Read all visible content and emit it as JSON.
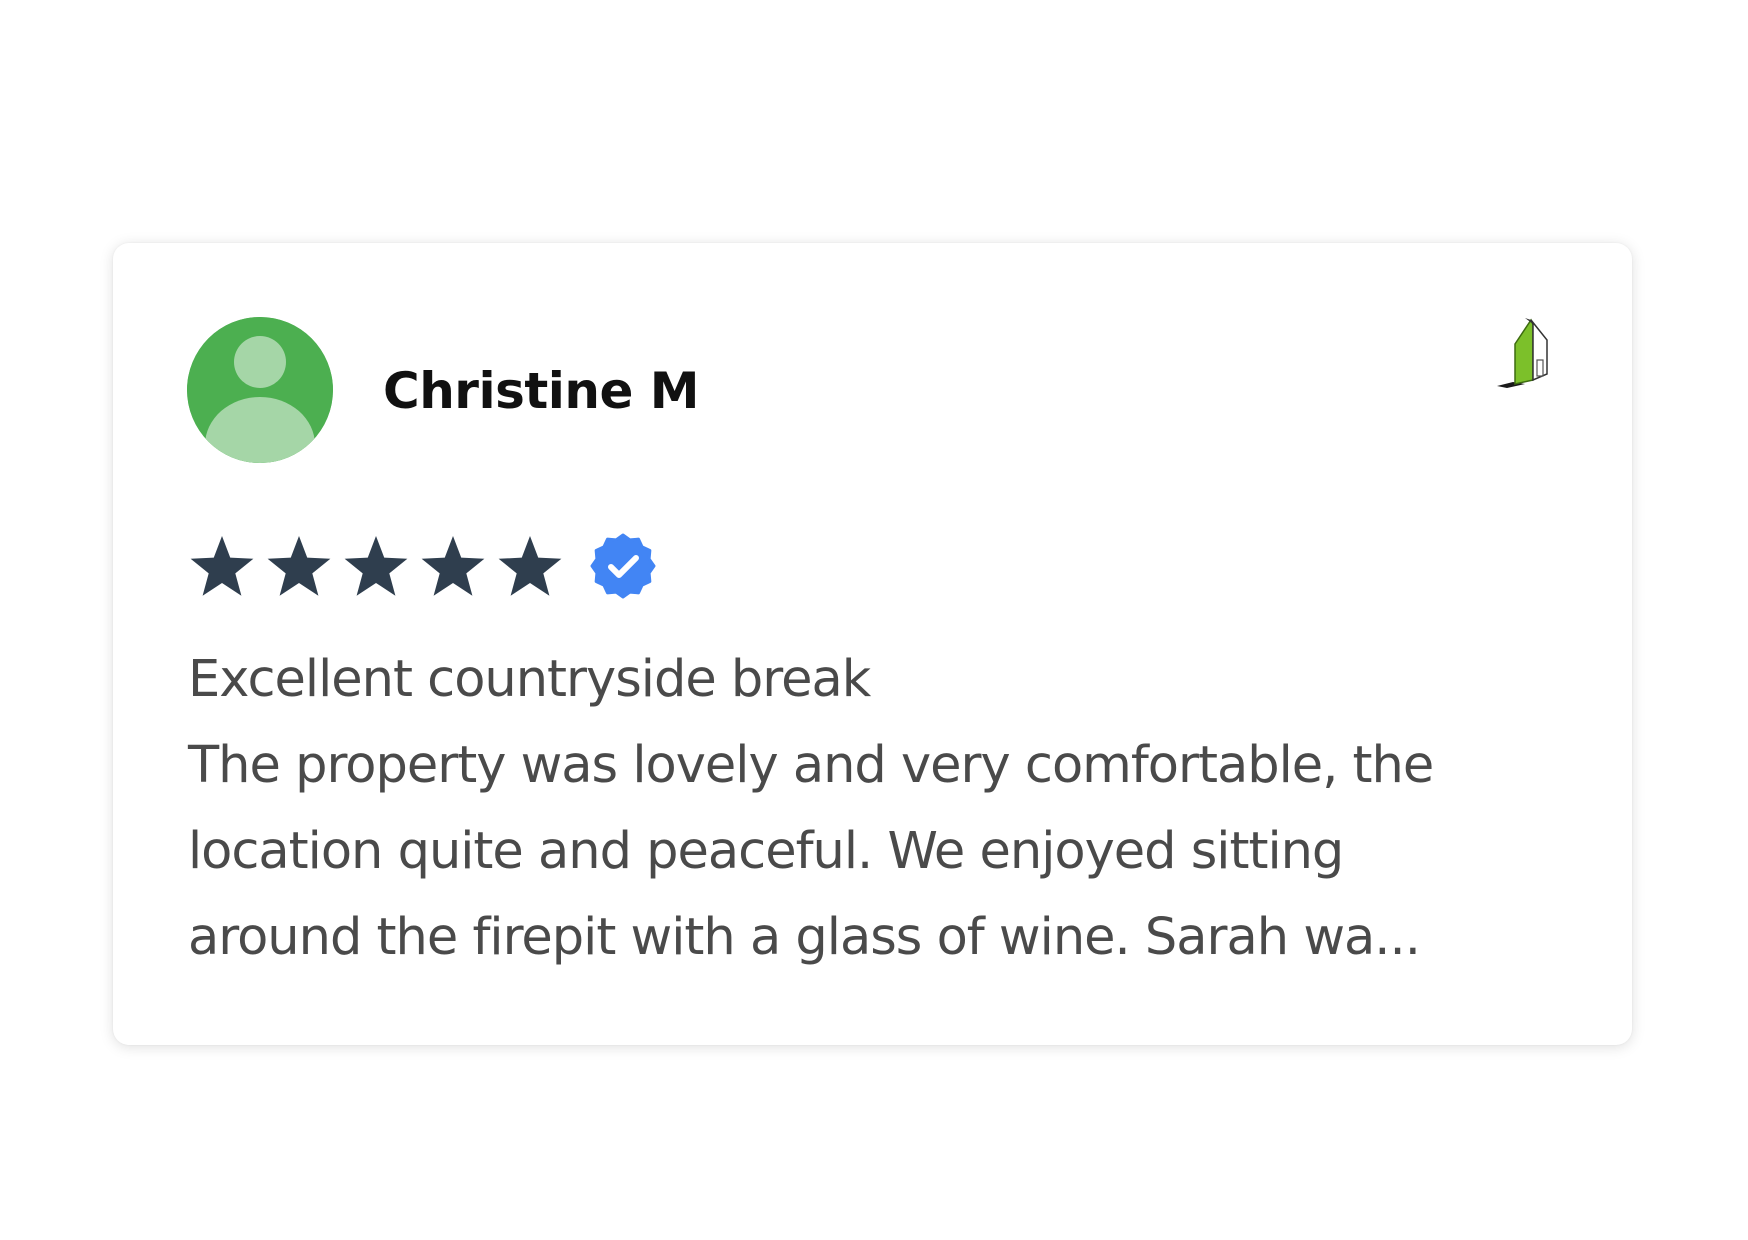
{
  "review": {
    "reviewer_name": "Christine M",
    "rating": 5,
    "rating_max": 5,
    "verified": true,
    "title": "Excellent countryside break",
    "body_lines": [
      "The property was lovely and very comfortable, the",
      "location quite and peaceful. We enjoyed sitting",
      "around the firepit with a glass of wine. Sarah wa..."
    ]
  },
  "icons": {
    "avatar": "person-placeholder-icon",
    "source_logo": "house-logo-icon",
    "star": "star-icon",
    "verified": "verified-badge-icon"
  },
  "colors": {
    "avatar_bg": "#4caf50",
    "avatar_figure": "#a5d6a7",
    "star": "#2f3e4e",
    "verified_badge": "#4285f4",
    "text_primary": "#111111",
    "text_body": "#4a4a4a",
    "logo_green": "#7cc02a"
  }
}
